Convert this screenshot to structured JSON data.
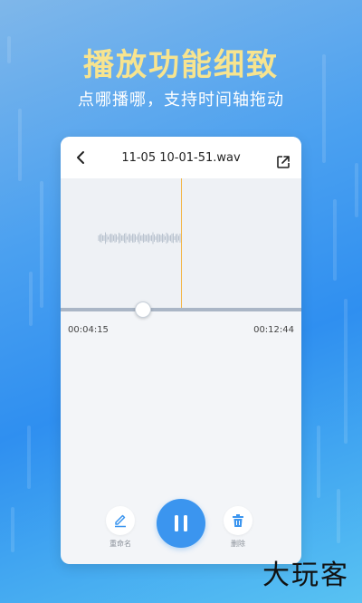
{
  "promo": {
    "headline": "播放功能细致",
    "subline": "点哪播哪，支持时间轴拖动"
  },
  "player": {
    "file_name": "11-05 10-01-51.wav",
    "current_time": "00:04:15",
    "total_time": "00:12:44",
    "progress_fraction": 0.34,
    "actions": {
      "rename_label": "重命名",
      "delete_label": "删除"
    }
  },
  "watermark": "大玩客",
  "colors": {
    "headline": "#f7e48f",
    "accent": "#3b95ef",
    "playhead": "#f3b544"
  }
}
